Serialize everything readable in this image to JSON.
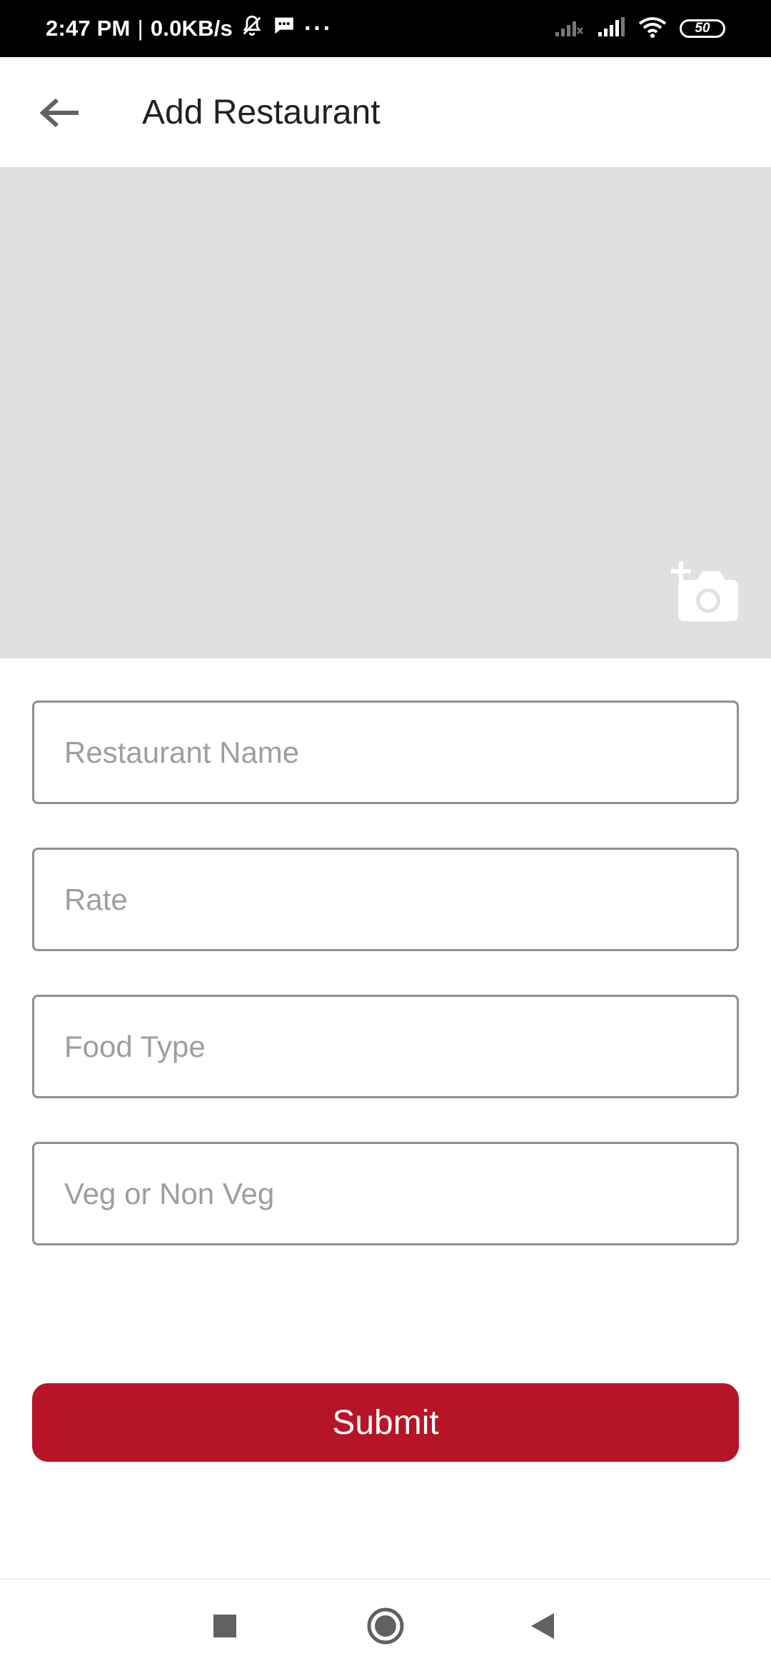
{
  "status_bar": {
    "time": "2:47 PM",
    "separator": "|",
    "speed": "0.0KB/s",
    "more": "···",
    "battery": "50",
    "icons": [
      "mute-bell-icon",
      "message-icon",
      "signal-weak-icon",
      "signal-icon",
      "wifi-icon",
      "battery-icon"
    ]
  },
  "app_bar": {
    "title": "Add Restaurant",
    "back_icon": "arrow-back-icon"
  },
  "photo": {
    "icon": "add-photo-icon",
    "background": "#e0e0e0"
  },
  "form": {
    "restaurant_name": {
      "placeholder": "Restaurant Name",
      "value": ""
    },
    "rate": {
      "placeholder": "Rate",
      "value": ""
    },
    "food_type": {
      "placeholder": "Food Type",
      "value": ""
    },
    "veg": {
      "placeholder": "Veg or Non Veg",
      "value": ""
    }
  },
  "submit": {
    "label": "Submit",
    "color": "#b71427"
  },
  "nav_bar": {
    "icons": [
      "recents-square-icon",
      "home-circle-icon",
      "back-triangle-icon"
    ]
  }
}
